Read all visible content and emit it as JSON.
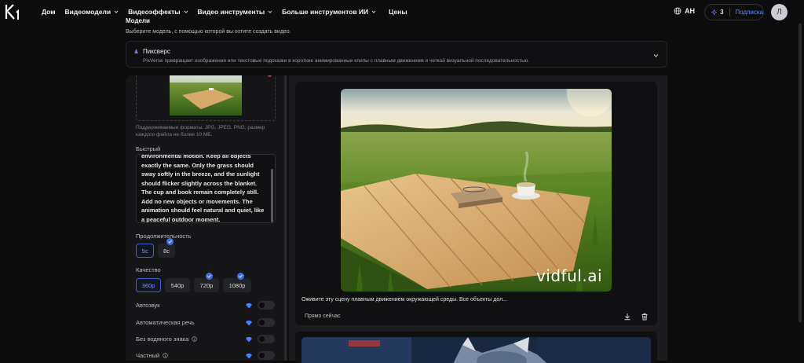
{
  "topbar": {
    "nav": [
      {
        "label": "Дом",
        "has_menu": false
      },
      {
        "label": "Видеомодели",
        "has_menu": true
      },
      {
        "label": "Видеоэффекты",
        "has_menu": true
      },
      {
        "label": "Видео инструменты",
        "has_menu": true
      },
      {
        "label": "Больше инструментов ИИ",
        "has_menu": true
      },
      {
        "label": "Цены",
        "has_menu": false
      }
    ],
    "language": "AH",
    "credits": "3",
    "subscribe_label": "Подписка",
    "avatar_letter": "Л"
  },
  "models": {
    "title": "Модели",
    "subtitle": "Выберите модель, с помощью которой вы хотите создать видео.",
    "selected_name": "Пиксверс",
    "selected_desc": "PixVerse превращает изображения или текстовые подсказки в короткие анимированные клипы с плавным движением и четкой визуальной последовательностью."
  },
  "left": {
    "upload_note": "Поддерживаемые форматы: JPG, JPEG, PNG; размер каждого файла не более 10 МБ.",
    "prompt_label": "Быстрый",
    "prompt_lines": [
      "environmental motion.  Keep all objects",
      "exactly the same.  Only the grass should",
      "sway softly in the breeze, and the sunlight",
      "should flicker slightly across the blanket.",
      "The cup and book remain completely still.",
      "Add no new objects or movements.  The",
      "animation should feel natural and quiet, like",
      "a peaceful outdoor moment."
    ],
    "duration_label": "Продолжительность",
    "durations": [
      {
        "label": "5с",
        "selected": true,
        "premium": false
      },
      {
        "label": "8с",
        "selected": false,
        "premium": true
      }
    ],
    "quality_label": "Качество",
    "qualities": [
      {
        "label": "360p",
        "selected": true,
        "premium": false
      },
      {
        "label": "540p",
        "selected": false,
        "premium": false
      },
      {
        "label": "720p",
        "selected": false,
        "premium": true
      },
      {
        "label": "1080p",
        "selected": false,
        "premium": true
      }
    ],
    "toggles": [
      {
        "label": "Автозвук",
        "info": false,
        "on": false
      },
      {
        "label": "Автоматическая речь",
        "info": false,
        "on": false
      },
      {
        "label": "Без водяного знака",
        "info": true,
        "on": false
      },
      {
        "label": "Частный",
        "info": true,
        "on": false
      }
    ]
  },
  "result": {
    "watermark": "vidful.ai",
    "caption": "Оживите эту сцену плавным движением окружающей среды. Все объекты дол...",
    "time": "Прямо сейчас"
  },
  "colors": {
    "accent": "#3d63c9",
    "background": "#0c0c0d",
    "panel": "#161618"
  }
}
